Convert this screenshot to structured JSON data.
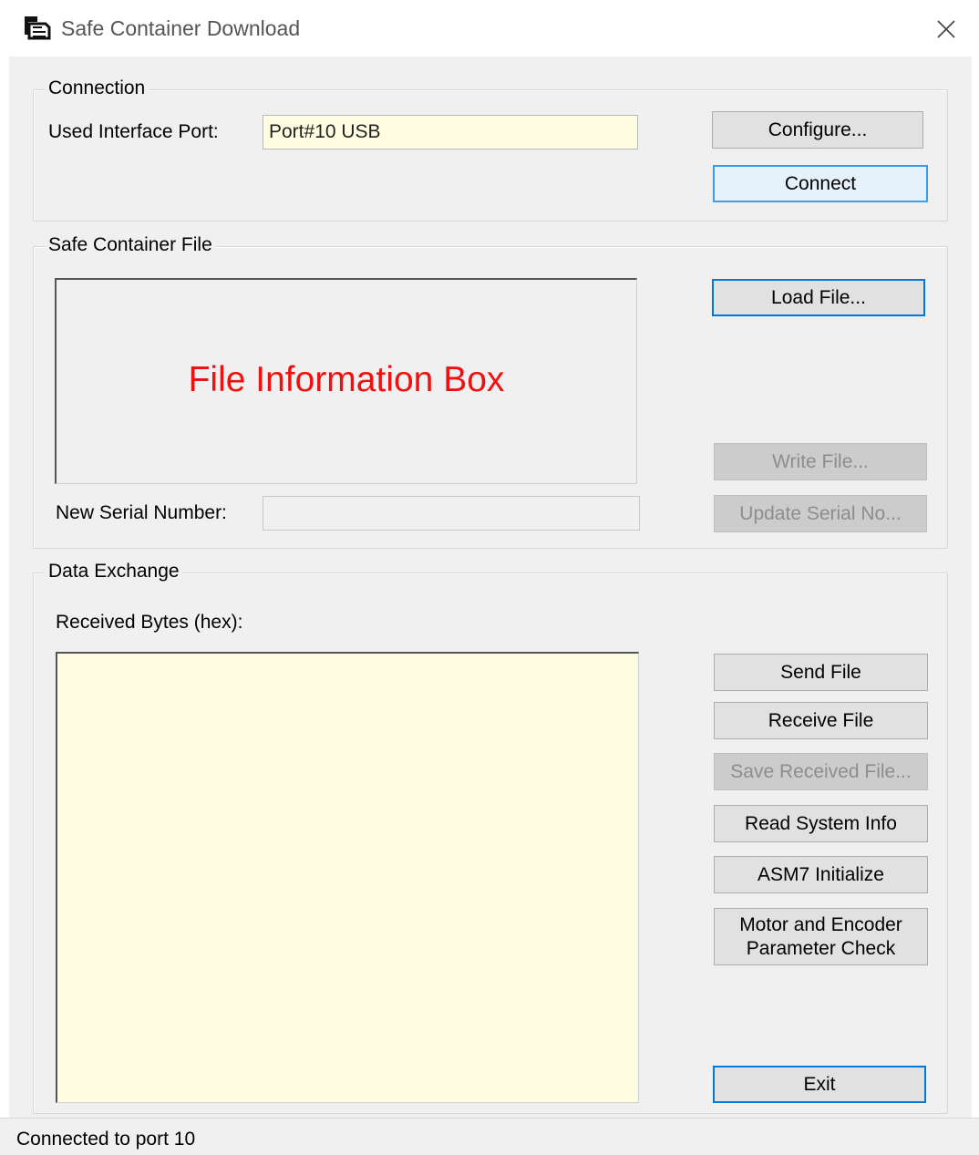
{
  "window": {
    "title": "Safe Container Download",
    "icon": "download-app-icon",
    "close_icon": "close-icon"
  },
  "connection": {
    "group_title": "Connection",
    "port_label": "Used Interface Port:",
    "port_value": "Port#10  USB",
    "configure_label": "Configure...",
    "connect_label": "Connect"
  },
  "safe_container": {
    "group_title": "Safe Container File",
    "info_box_caption": "File Information Box",
    "load_file_label": "Load File...",
    "write_file_label": "Write File...",
    "serial_label": "New Serial Number:",
    "serial_value": "",
    "update_serial_label": "Update Serial No..."
  },
  "data_exchange": {
    "group_title": "Data Exchange",
    "received_label": "Received Bytes (hex):",
    "received_value": "",
    "send_file_label": "Send File",
    "receive_file_label": "Receive File",
    "save_received_label": "Save Received File...",
    "read_system_info_label": "Read System Info",
    "asm7_init_label": "ASM7 Initialize",
    "motor_check_line1": "Motor and Encoder",
    "motor_check_line2": "Parameter Check",
    "exit_label": "Exit"
  },
  "colors": {
    "info_caption": "#ee1111",
    "textbox_bg": "#fffde1",
    "focus_border": "#0078d7"
  },
  "status": {
    "text": "Connected to port 10"
  }
}
